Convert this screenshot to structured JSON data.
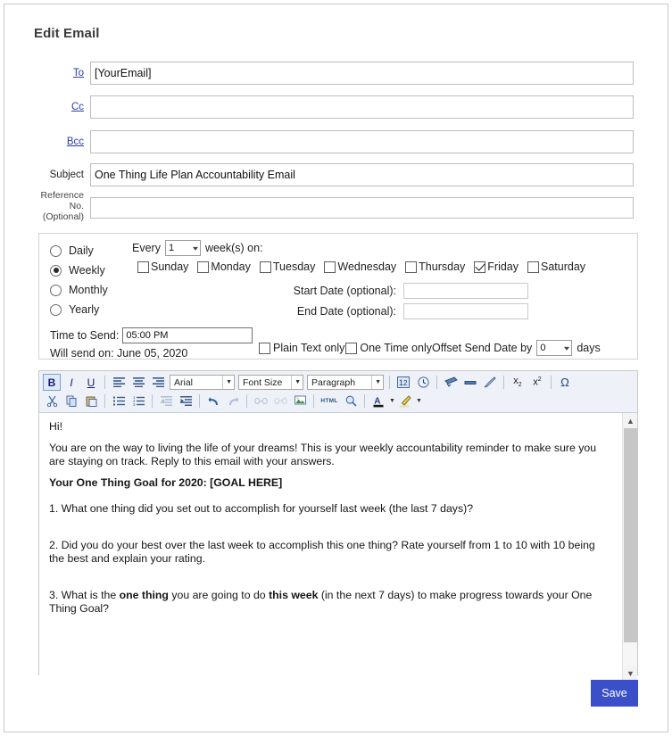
{
  "page": {
    "title": "Edit Email"
  },
  "fields": {
    "to": {
      "label": "To",
      "value": "[YourEmail]",
      "placeholder": ""
    },
    "cc": {
      "label": "Cc",
      "value": "",
      "placeholder": ""
    },
    "bcc": {
      "label": "Bcc",
      "value": "",
      "placeholder": ""
    },
    "subject": {
      "label": "Subject",
      "value": "One Thing Life Plan Accountability Email",
      "placeholder": ""
    },
    "reference": {
      "label_line1": "Reference",
      "label_line2": "No.",
      "label_line3": "(Optional)",
      "value": "",
      "placeholder": ""
    }
  },
  "schedule": {
    "frequency_options": [
      {
        "label": "Daily",
        "selected": false
      },
      {
        "label": "Weekly",
        "selected": true
      },
      {
        "label": "Monthly",
        "selected": false
      },
      {
        "label": "Yearly",
        "selected": false
      }
    ],
    "every_prefix": "Every",
    "every_value": "1",
    "every_suffix": "week(s) on:",
    "days": [
      {
        "label": "Sunday",
        "checked": false
      },
      {
        "label": "Monday",
        "checked": false
      },
      {
        "label": "Tuesday",
        "checked": false
      },
      {
        "label": "Wednesday",
        "checked": false
      },
      {
        "label": "Thursday",
        "checked": false
      },
      {
        "label": "Friday",
        "checked": true
      },
      {
        "label": "Saturday",
        "checked": false
      }
    ],
    "start_date": {
      "label": "Start Date (optional):",
      "value": ""
    },
    "end_date": {
      "label": "End Date (optional):",
      "value": ""
    },
    "time_to_send": {
      "label": "Time to Send:",
      "value": "05:00 PM"
    },
    "will_send_on": "Will send on: June 05, 2020",
    "plain_text_only": {
      "label": "Plain Text only",
      "checked": false
    },
    "one_time_only": {
      "label": "One Time only",
      "checked": false
    },
    "offset": {
      "prefix": "Offset Send Date by",
      "value": "0",
      "suffix": "days"
    }
  },
  "editor": {
    "toolbar": {
      "font_family": "Arial",
      "font_size": "Font Size",
      "paragraph": "Paragraph",
      "row1_icons": [
        "bold-icon",
        "italic-icon",
        "underline-icon",
        "align-left-icon",
        "align-center-icon",
        "align-right-icon"
      ],
      "row1_icons_right": [
        "insert-field-icon",
        "insert-time-icon",
        "paint-format-icon",
        "remove-format-icon",
        "eraser-icon",
        "subscript-icon",
        "superscript-icon",
        "special-character-icon"
      ],
      "row2_icons": [
        "cut-icon",
        "copy-icon",
        "paste-icon",
        "bullet-list-icon",
        "numbered-list-icon",
        "outdent-icon",
        "indent-icon",
        "undo-icon",
        "redo-icon",
        "link-icon",
        "unlink-icon",
        "insert-image-icon",
        "html-source-icon",
        "find-icon",
        "font-color-icon",
        "highlight-color-icon"
      ]
    },
    "body": {
      "greeting": "Hi!",
      "intro": "You are on the way to living the life of your dreams! This is your weekly accountability reminder to make sure you are staying on track. Reply to this email with your answers.",
      "goal_heading": "Your One Thing Goal for 2020: [GOAL HERE]",
      "q1": "1. What one thing did you set out to accomplish for yourself last week (the last 7 days)?",
      "q2": "2. Did you do your best over the last week to accomplish this one thing? Rate yourself from 1 to 10 with 10 being the best and explain your rating.",
      "q3_part1": "3. What is the ",
      "q3_bold1": "one thing",
      "q3_part2": " you are going to do ",
      "q3_bold2": "this week",
      "q3_part3": " (in the next 7 days) to make progress towards your One Thing Goal?"
    }
  },
  "actions": {
    "save_label": "Save"
  },
  "colors": {
    "accent": "#3b4fc8",
    "link": "#2b3ea8",
    "toolbar_bg": "#eef2f8"
  }
}
